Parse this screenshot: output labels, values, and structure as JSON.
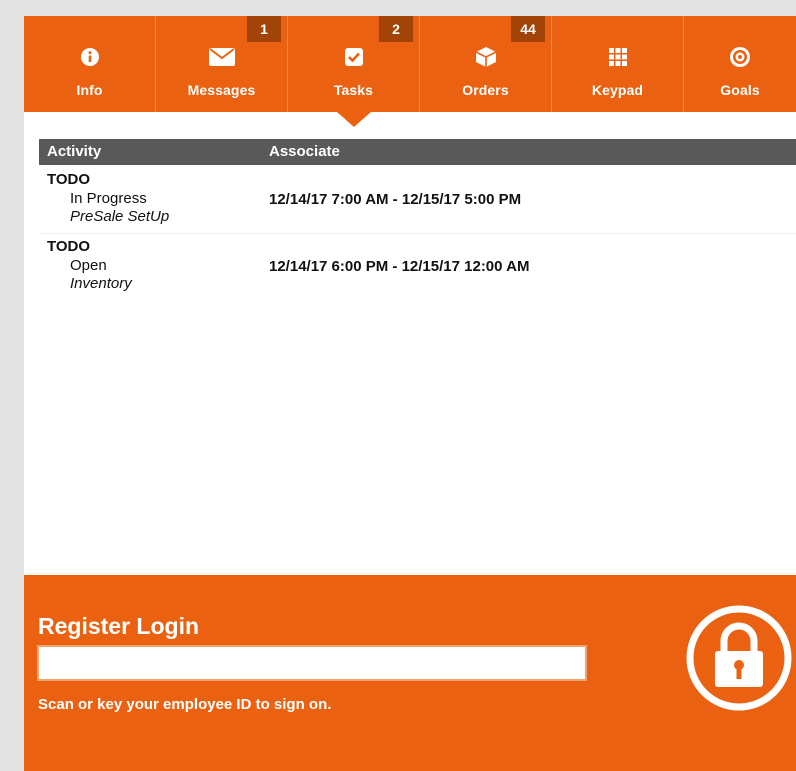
{
  "nav": {
    "items": [
      {
        "label": "Info",
        "icon": "info-icon",
        "badge": ""
      },
      {
        "label": "Messages",
        "icon": "envelope-icon",
        "badge": "1"
      },
      {
        "label": "Tasks",
        "icon": "checkbox-icon",
        "badge": "2"
      },
      {
        "label": "Orders",
        "icon": "box-icon",
        "badge": "44"
      },
      {
        "label": "Keypad",
        "icon": "keypad-icon",
        "badge": ""
      },
      {
        "label": "Goals",
        "icon": "target-icon",
        "badge": ""
      }
    ],
    "selected": "Tasks"
  },
  "table": {
    "headers": {
      "activity": "Activity",
      "associate": "Associate"
    },
    "rows": [
      {
        "type": "TODO",
        "status": "In Progress",
        "category": "PreSale SetUp",
        "time": "12/14/17 7:00 AM - 12/15/17 5:00 PM"
      },
      {
        "type": "TODO",
        "status": "Open",
        "category": "Inventory",
        "time": "12/14/17 6:00 PM - 12/15/17 12:00 AM"
      }
    ]
  },
  "login": {
    "title": "Register Login",
    "input_value": "",
    "input_placeholder": "",
    "hint": "Scan or key your employee ID to sign on.",
    "icon": "lock-icon"
  },
  "colors": {
    "accent": "#ea6211",
    "badge": "#a24408",
    "table_header": "#595959",
    "page_background": "#e4e4e4"
  }
}
